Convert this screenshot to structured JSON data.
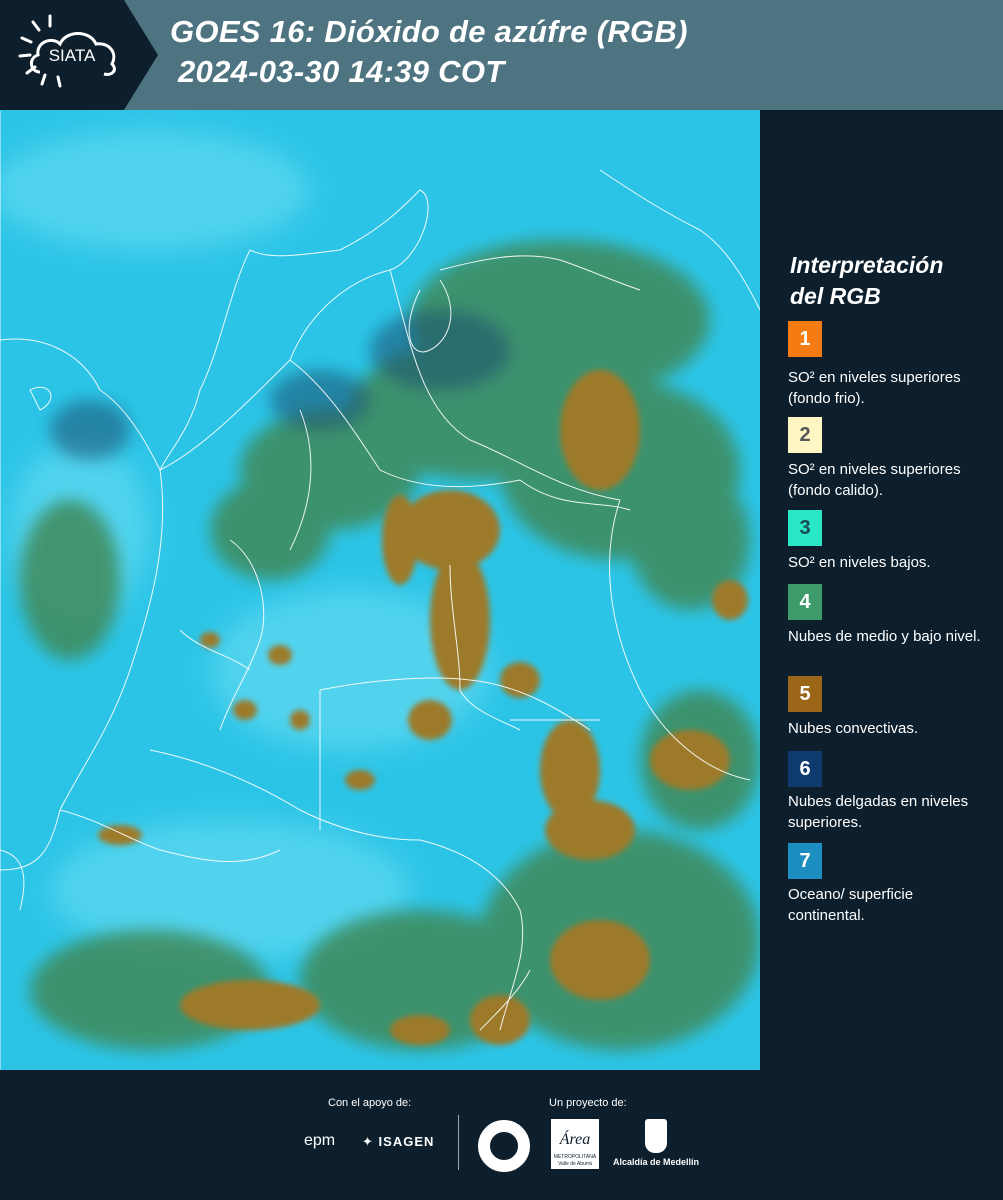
{
  "header": {
    "logo_text": "SIATA",
    "title_line1": "GOES 16: Dióxido de azúfre (RGB)",
    "title_line2": "2024-03-30 14:39 COT"
  },
  "map": {
    "description_colors": {
      "background_cyan": "#2cc4e6",
      "land_green": "#3f8a5a",
      "convective_brown": "#9c7a2a",
      "thin_cloud_dark": "#1f4f6e",
      "border_line": "#ffffff"
    }
  },
  "legend": {
    "title_line1": "Interpretación",
    "title_line2": "del RGB",
    "items": [
      {
        "number": "1",
        "color": "#f47c12",
        "text_color": "#ffffff",
        "label": "SO² en niveles superiores (fondo frio)."
      },
      {
        "number": "2",
        "color": "#fef6c4",
        "text_color": "#555555",
        "label": "SO² en niveles superiores (fondo calido)."
      },
      {
        "number": "3",
        "color": "#29e8c8",
        "text_color": "#1a4a50",
        "label": "SO² en niveles bajos."
      },
      {
        "number": "4",
        "color": "#3d9a6a",
        "text_color": "#ffffff",
        "label": "Nubes de medio y bajo nivel."
      },
      {
        "number": "5",
        "color": "#9b6617",
        "text_color": "#ffffff",
        "label": "Nubes convectivas."
      },
      {
        "number": "6",
        "color": "#0f3a6e",
        "text_color": "#ffffff",
        "label": "Nubes delgadas en niveles superiores."
      },
      {
        "number": "7",
        "color": "#1c8fc0",
        "text_color": "#ffffff",
        "label": "Oceano/ superficie continental."
      }
    ]
  },
  "footer": {
    "support_caption": "Con el apoyo de:",
    "project_caption": "Un proyecto de:",
    "sponsor_epm": "epm",
    "sponsor_isagen": "ISAGEN",
    "metro_name": "Área",
    "metro_sub1": "METROPOLITANA",
    "metro_sub2": "Valle de Aburrá",
    "alcaldia": "Alcaldía de Medellín"
  }
}
